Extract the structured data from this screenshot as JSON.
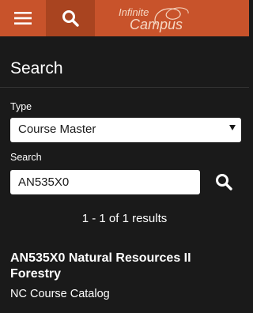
{
  "topbar": {
    "menu_icon": "hamburger-menu-icon",
    "search_icon": "search-icon",
    "logo_line1": "Infinite",
    "logo_line2": "Campus",
    "colors": {
      "bar": "#c8532b",
      "active": "#a94420"
    }
  },
  "header": {
    "title": "Search"
  },
  "form": {
    "type_label": "Type",
    "type_value": "Course Master",
    "search_label": "Search",
    "search_value": "AN535X0"
  },
  "results": {
    "count_text": "1 - 1 of 1 results",
    "items": [
      {
        "title": "AN535X0 Natural Resources II Forestry",
        "subtitle": "NC Course Catalog"
      }
    ]
  }
}
